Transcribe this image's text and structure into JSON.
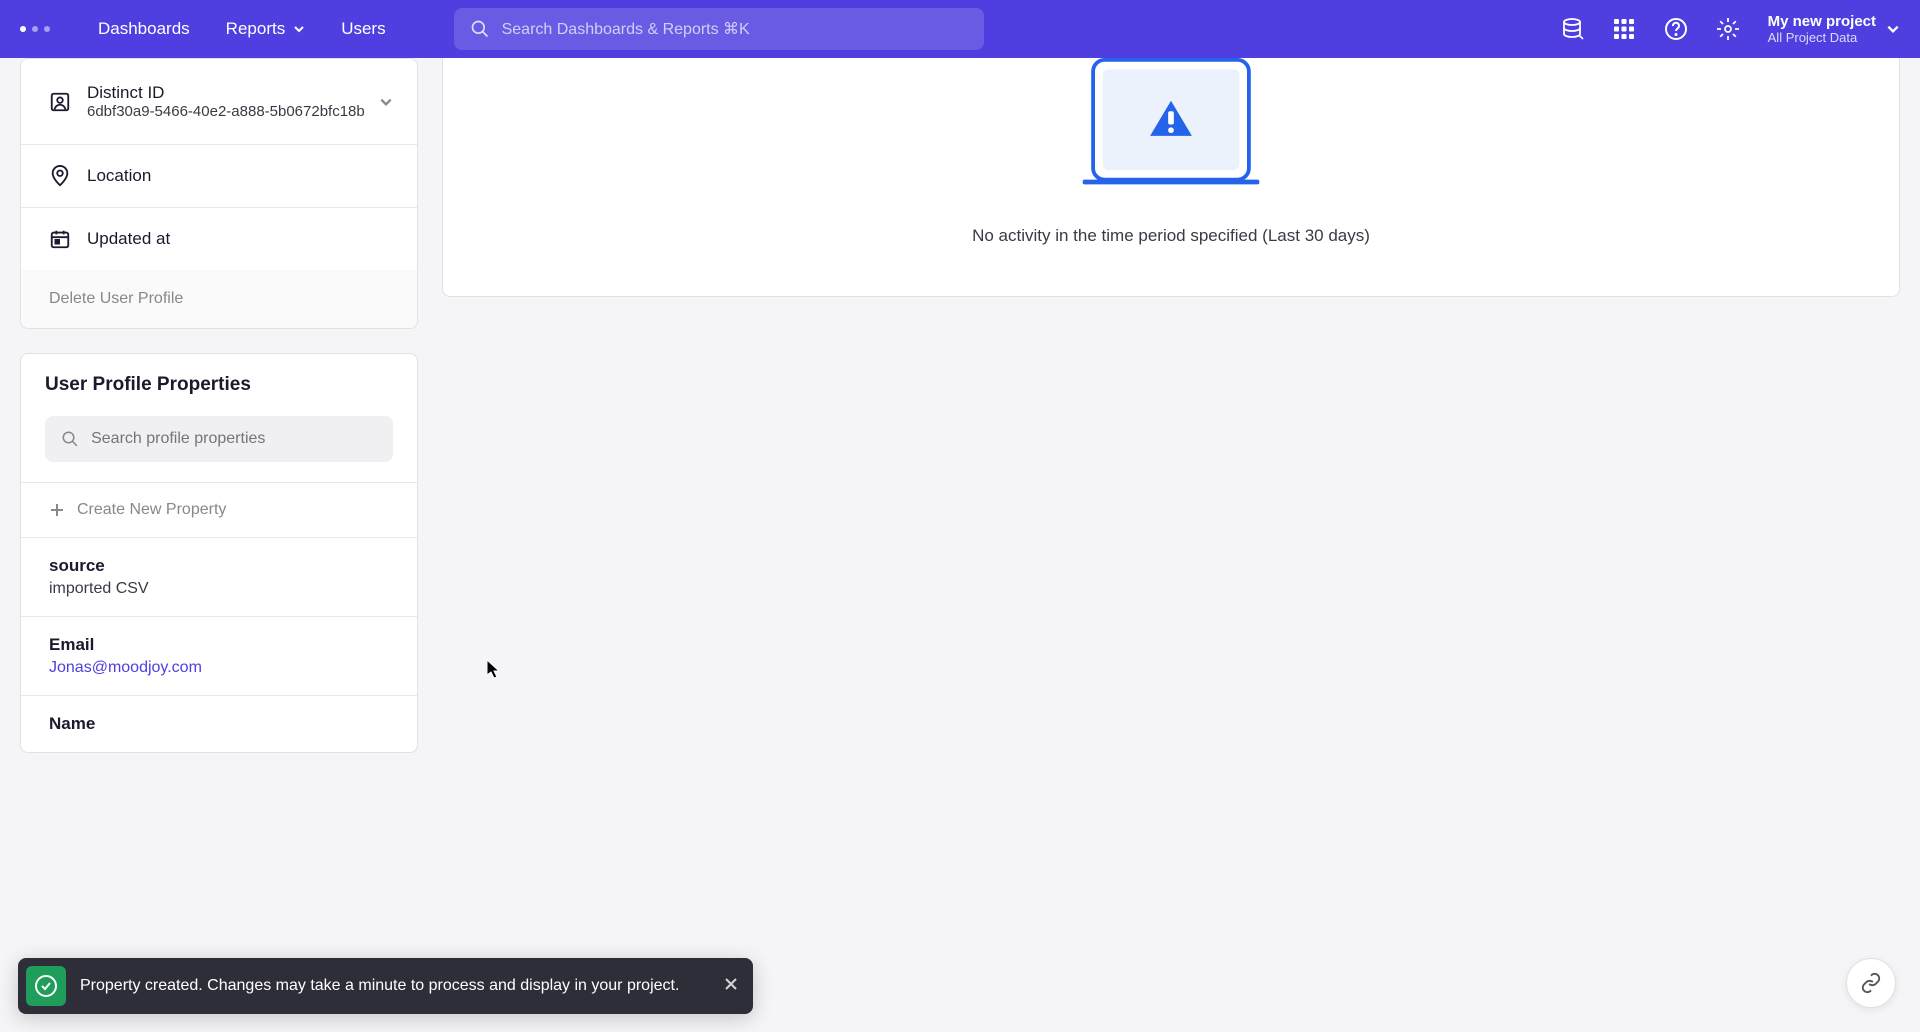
{
  "nav": {
    "dashboards": "Dashboards",
    "reports": "Reports",
    "users": "Users"
  },
  "search": {
    "placeholder": "Search Dashboards & Reports ⌘K"
  },
  "project": {
    "name": "My new project",
    "subtitle": "All Project Data"
  },
  "userInfo": {
    "distinctId": {
      "label": "Distinct ID",
      "value": "6dbf30a9-5466-40e2-a888-5b0672bfc18b"
    },
    "location": {
      "label": "Location"
    },
    "updatedAt": {
      "label": "Updated at"
    },
    "delete": "Delete User Profile"
  },
  "properties": {
    "title": "User Profile Properties",
    "searchPlaceholder": "Search profile properties",
    "createNew": "Create New Property",
    "items": [
      {
        "label": "source",
        "value": "imported CSV",
        "isLink": false
      },
      {
        "label": "Email",
        "value": "Jonas@moodjoy.com",
        "isLink": true
      },
      {
        "label": "Name",
        "value": "",
        "isLink": false
      }
    ]
  },
  "emptyState": {
    "message": "No activity in the time period specified (Last 30 days)"
  },
  "toast": {
    "message": "Property created. Changes may take a minute to process and display in your project."
  }
}
